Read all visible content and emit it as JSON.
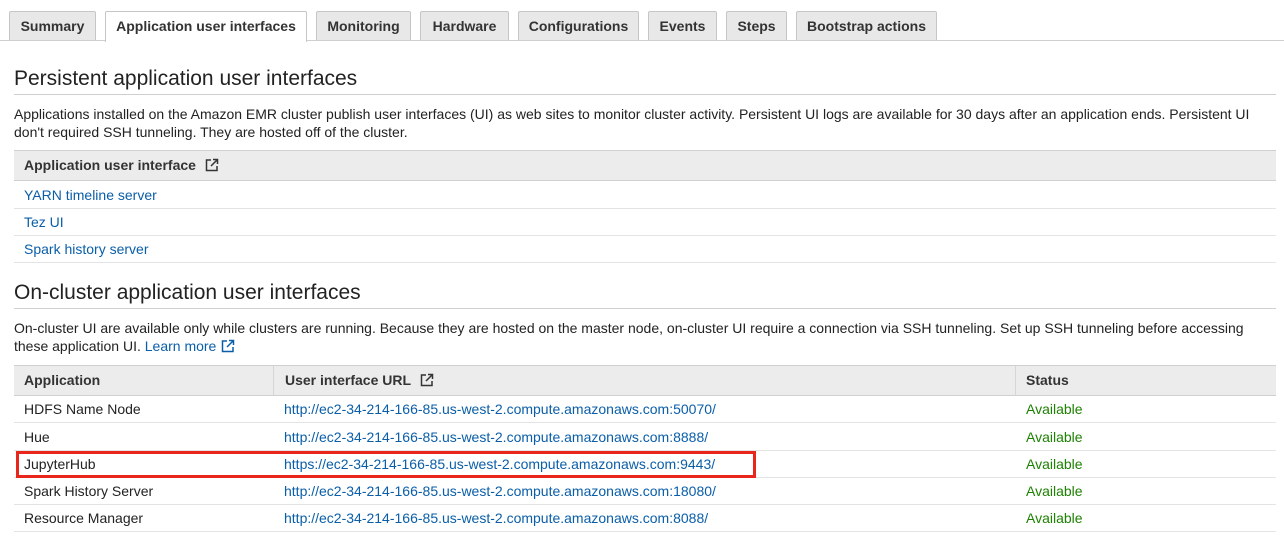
{
  "tabs": [
    {
      "label": "Summary",
      "active": false
    },
    {
      "label": "Application user interfaces",
      "active": true
    },
    {
      "label": "Monitoring",
      "active": false
    },
    {
      "label": "Hardware",
      "active": false
    },
    {
      "label": "Configurations",
      "active": false
    },
    {
      "label": "Events",
      "active": false
    },
    {
      "label": "Steps",
      "active": false
    },
    {
      "label": "Bootstrap actions",
      "active": false
    }
  ],
  "persistent": {
    "title": "Persistent application user interfaces",
    "description": "Applications installed on the Amazon EMR cluster publish user interfaces (UI) as web sites to monitor cluster activity. Persistent UI logs are available for 30 days after an application ends. Persistent UI don't required SSH tunneling. They are hosted off of the cluster.",
    "table_header": "Application user interface",
    "items": [
      "YARN timeline server",
      "Tez UI",
      "Spark history server"
    ]
  },
  "oncluster": {
    "title": "On-cluster application user interfaces",
    "description": "On-cluster UI are available only while clusters are running. Because they are hosted on the master node, on-cluster UI require a connection via SSH tunneling. Set up SSH tunneling before accessing these application UI.",
    "learn_more": "Learn more",
    "columns": {
      "application": "Application",
      "url": "User interface URL",
      "status": "Status"
    },
    "rows": [
      {
        "application": "HDFS Name Node",
        "url": "http://ec2-34-214-166-85.us-west-2.compute.amazonaws.com:50070/",
        "status": "Available"
      },
      {
        "application": "Hue",
        "url": "http://ec2-34-214-166-85.us-west-2.compute.amazonaws.com:8888/",
        "status": "Available"
      },
      {
        "application": "JupyterHub",
        "url": "https://ec2-34-214-166-85.us-west-2.compute.amazonaws.com:9443/",
        "status": "Available"
      },
      {
        "application": "Spark History Server",
        "url": "http://ec2-34-214-166-85.us-west-2.compute.amazonaws.com:18080/",
        "status": "Available"
      },
      {
        "application": "Resource Manager",
        "url": "http://ec2-34-214-166-85.us-west-2.compute.amazonaws.com:8088/",
        "status": "Available"
      }
    ]
  },
  "colors": {
    "link": "#0a5ea8",
    "available": "#1d8102",
    "highlight": "#e8261b"
  },
  "icons": {
    "external": "external-link-icon"
  }
}
